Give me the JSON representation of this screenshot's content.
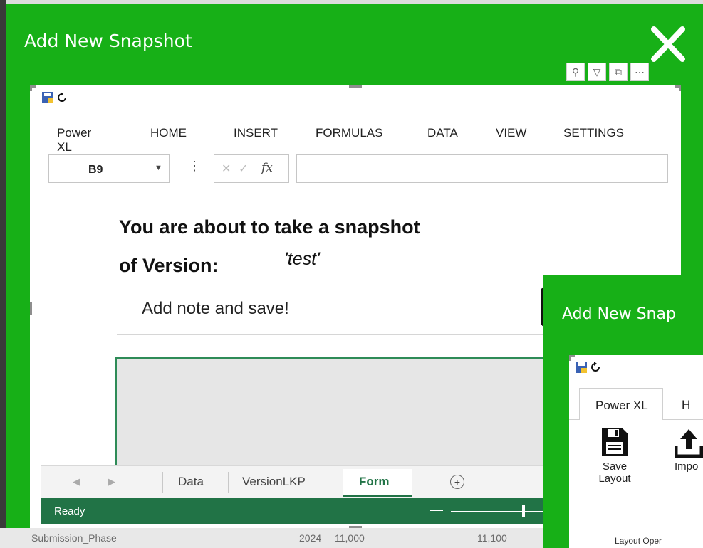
{
  "outer_dialog": {
    "title": "Add New Snapshot",
    "close_glyph": "✕"
  },
  "visual_toolbar": [
    {
      "icon": "pin-icon",
      "glyph": "⚲"
    },
    {
      "icon": "filter-icon",
      "glyph": "▽"
    },
    {
      "icon": "focus-mode-icon",
      "glyph": "⧉"
    },
    {
      "icon": "more-options-icon",
      "glyph": "⋯"
    }
  ],
  "ribbon_tabs": [
    "Power XL",
    "HOME",
    "INSERT",
    "FORMULAS",
    "DATA",
    "VIEW",
    "SETTINGS"
  ],
  "formula_bar": {
    "name_box": "B9",
    "cancel_glyph": "✕",
    "enter_glyph": "✓",
    "fx_label": "fx",
    "dots": "⋮"
  },
  "form": {
    "heading_line1": "You are about to take a snapshot",
    "heading_line2": "of Version:",
    "version": "'test'",
    "note_placeholder": "Add note and save!"
  },
  "sheet_tabs": {
    "prev": "◀",
    "next": "▶",
    "tabs": [
      "Data",
      "VersionLKP",
      "Form"
    ],
    "active": "Form",
    "add_glyph": "+"
  },
  "status_bar": {
    "status": "Ready",
    "zoom_minus": "—"
  },
  "second_dialog": {
    "title": "Add New Snap",
    "tabs": [
      "Power XL",
      "H"
    ],
    "buttons": [
      {
        "label_line1": "Save",
        "label_line2": "Layout",
        "icon": "save-layout-icon"
      },
      {
        "label_line1": "Impo",
        "label_line2": "",
        "icon": "import-icon"
      }
    ],
    "group_label": "Layout Oper"
  },
  "background_strip": [
    "Submission_Phase",
    "2024",
    "11,000",
    "11,100"
  ],
  "colors": {
    "dialog_green": "#17b017",
    "excel_green": "#217346"
  }
}
